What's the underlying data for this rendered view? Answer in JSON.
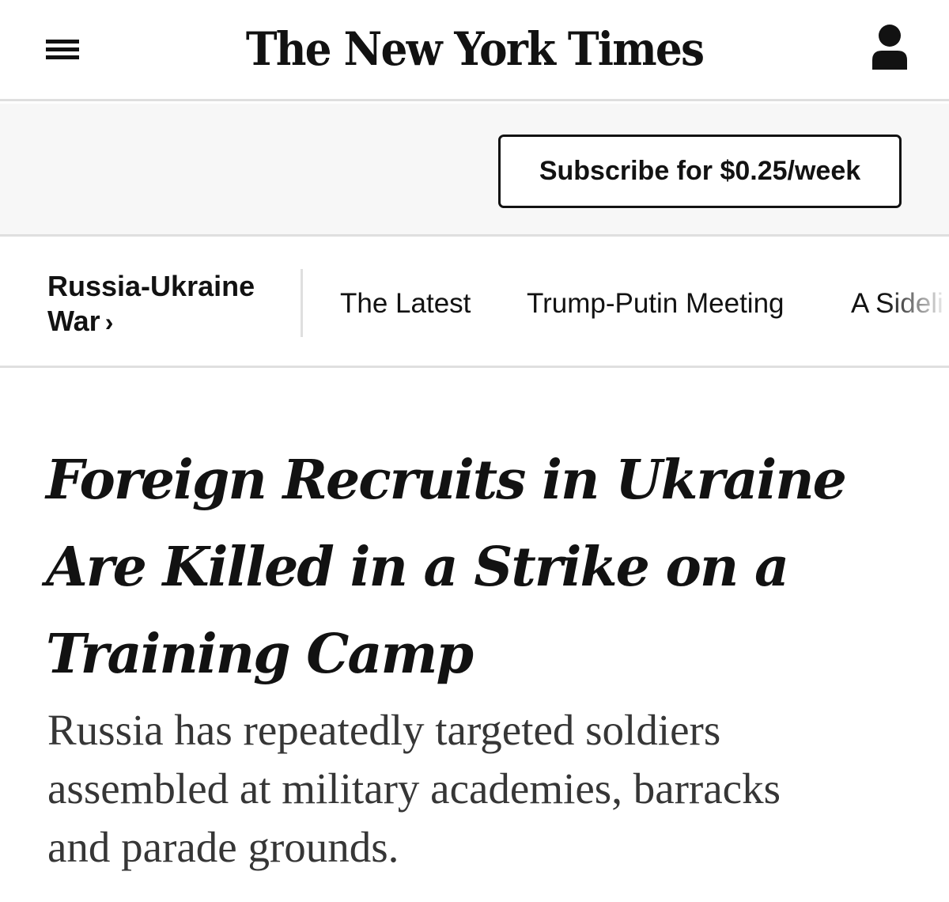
{
  "header": {
    "logo_text": "The New York Times",
    "menu_icon": "hamburger-menu-icon",
    "account_icon": "user-account-icon"
  },
  "subscribe": {
    "label": "Subscribe for $0.25/week"
  },
  "section_nav": {
    "section_line1": "Russia-Ukraine",
    "section_line2": "War",
    "section_chevron": "›",
    "links": [
      {
        "label": "The Latest"
      },
      {
        "label": "Trump-Putin Meeting"
      },
      {
        "label": "A Sideli"
      }
    ]
  },
  "article": {
    "headline_lines": [
      "Foreign Recruits in Ukraine",
      "Are Killed in a Strike on a",
      "Training Camp"
    ],
    "summary_lines": [
      "Russia has repeatedly targeted soldiers",
      "assembled at military academies, barracks",
      "and parade grounds."
    ]
  },
  "colors": {
    "text": "#121212",
    "summary_text": "#363636",
    "band_background": "#f7f7f7",
    "divider": "#dfdfdf"
  }
}
